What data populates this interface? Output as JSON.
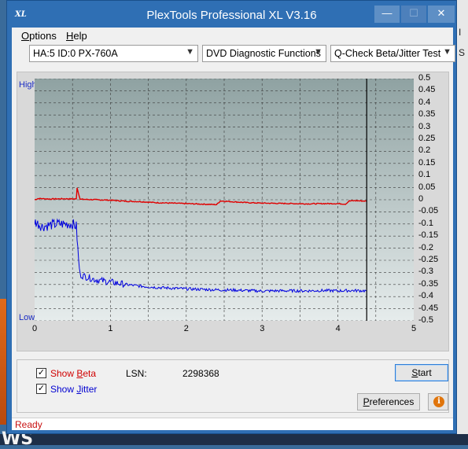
{
  "window": {
    "title": "PlexTools Professional XL V3.16",
    "icon_text": "XL",
    "buttons": {
      "minimize": "—",
      "maximize": "☐",
      "close": "✕"
    }
  },
  "menu": [
    {
      "label_pre": "",
      "label_ul": "O",
      "label_post": "ptions"
    },
    {
      "label_pre": "",
      "label_ul": "H",
      "label_post": "elp"
    }
  ],
  "toolbar": {
    "drive": "HA:5 ID:0  PX-760A",
    "function": "DVD Diagnostic Functions",
    "test": "Q-Check Beta/Jitter Test"
  },
  "chart_data": {
    "type": "line",
    "left_axis": {
      "top_label": "High",
      "bottom_label": "Low"
    },
    "right_axis": {
      "ylim": [
        -0.5,
        0.5
      ],
      "ticks": [
        "0.5",
        "0.45",
        "0.4",
        "0.35",
        "0.3",
        "0.25",
        "0.2",
        "0.15",
        "0.1",
        "0.05",
        "0",
        "-0.05",
        "-0.1",
        "-0.15",
        "-0.2",
        "-0.25",
        "-0.3",
        "-0.35",
        "-0.4",
        "-0.45",
        "-0.5"
      ]
    },
    "x_axis": {
      "xlim": [
        0,
        5
      ],
      "ticks": [
        "0",
        "1",
        "2",
        "3",
        "4",
        "5"
      ]
    },
    "grid": true,
    "end_marker_x": 4.38,
    "series": [
      {
        "color": "#e00000",
        "x": [
          0,
          0.05,
          0.2,
          0.4,
          0.55,
          0.56,
          0.6,
          0.8,
          1.0,
          1.2,
          1.4,
          1.6,
          1.8,
          2.0,
          2.2,
          2.4,
          2.45,
          2.6,
          2.8,
          3.0,
          3.2,
          3.4,
          3.6,
          3.8,
          4.0,
          4.1,
          4.15,
          4.25,
          4.38
        ],
        "y": [
          0.0,
          0.005,
          0.003,
          0.004,
          0.003,
          0.05,
          0.002,
          0.0,
          -0.002,
          -0.006,
          -0.008,
          -0.012,
          -0.014,
          -0.016,
          -0.018,
          -0.02,
          -0.005,
          -0.008,
          -0.012,
          -0.014,
          -0.015,
          -0.016,
          -0.017,
          -0.016,
          -0.016,
          -0.018,
          -0.005,
          -0.004,
          -0.006
        ]
      },
      {
        "color": "#0000e0",
        "x": [
          0,
          0.05,
          0.1,
          0.2,
          0.3,
          0.4,
          0.5,
          0.55,
          0.58,
          0.6,
          0.7,
          0.8,
          1.0,
          1.2,
          1.4,
          1.6,
          1.8,
          2.0,
          2.2,
          2.4,
          2.6,
          2.8,
          3.0,
          3.2,
          3.4,
          3.6,
          3.8,
          4.0,
          4.2,
          4.38
        ],
        "y": [
          -0.09,
          -0.1,
          -0.11,
          -0.105,
          -0.1,
          -0.1,
          -0.1,
          -0.11,
          -0.25,
          -0.31,
          -0.32,
          -0.33,
          -0.34,
          -0.35,
          -0.357,
          -0.362,
          -0.365,
          -0.368,
          -0.37,
          -0.372,
          -0.373,
          -0.375,
          -0.377,
          -0.376,
          -0.376,
          -0.376,
          -0.375,
          -0.376,
          -0.375,
          -0.376
        ]
      }
    ]
  },
  "options": {
    "show_beta": {
      "pre": "Show ",
      "ul": "B",
      "post": "eta",
      "color": "#d00000",
      "checked": "✓"
    },
    "show_jitter": {
      "pre": "Show ",
      "ul": "J",
      "post": "itter",
      "color": "#0000d0",
      "checked": "✓"
    }
  },
  "lsn": {
    "label": "LSN:",
    "value": "2298368"
  },
  "buttons": {
    "start": {
      "ul": "S",
      "post": "tart"
    },
    "preferences": {
      "ul": "P",
      "post": "references"
    },
    "info_icon": "i"
  },
  "status": {
    "text": "Ready"
  },
  "desktop": {
    "bottom_text": "WS"
  },
  "colors": {
    "title_bar": "#2f6fb4",
    "plot_bg": "#a9b8b8",
    "beta": "#e00000",
    "jitter": "#0000e0",
    "status": "#c81010"
  }
}
